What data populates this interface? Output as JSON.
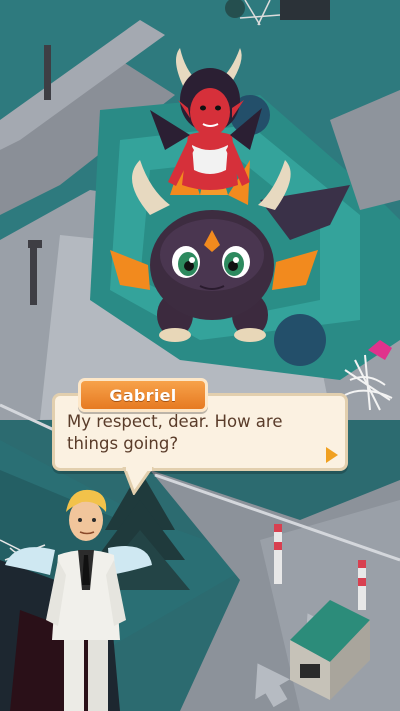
{
  "dialog": {
    "speaker": "Gabriel",
    "text": "My respect, dear. How are things going?"
  },
  "colors": {
    "name_tab": "#f08d32",
    "bubble_bg": "#fbf1e1",
    "text": "#5a3c2a",
    "next_arrow": "#f0a020"
  },
  "icons": [
    "next-arrow-icon"
  ]
}
